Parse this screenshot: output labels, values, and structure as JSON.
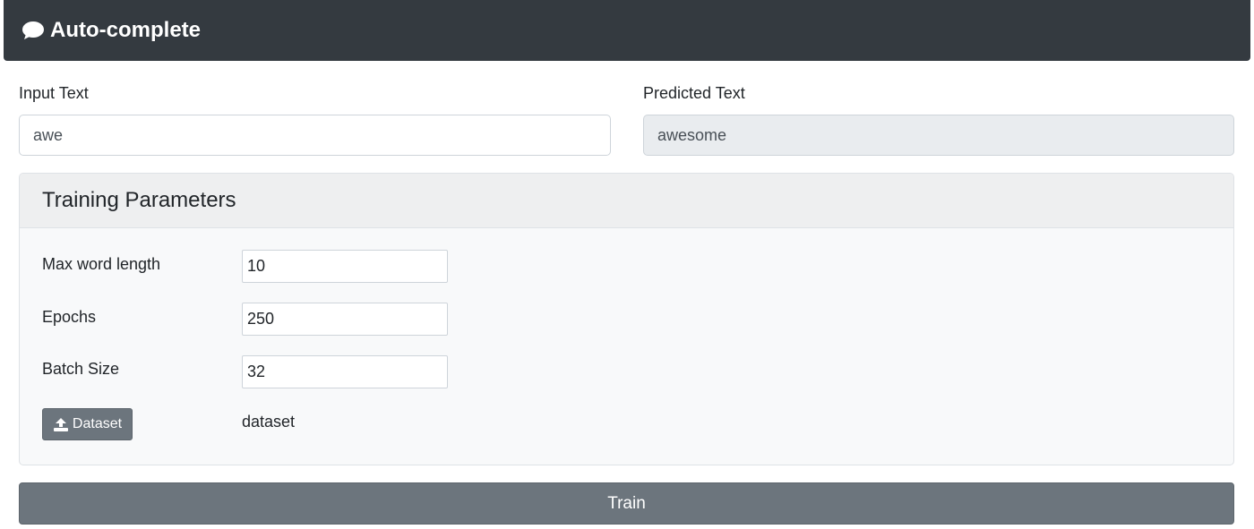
{
  "app": {
    "title": "Auto-complete",
    "icon": "comment-icon"
  },
  "input": {
    "label": "Input Text",
    "value": "awe"
  },
  "prediction": {
    "label": "Predicted Text",
    "value": "awesome"
  },
  "training": {
    "title": "Training Parameters",
    "params": [
      {
        "label": "Max word length",
        "value": "10"
      },
      {
        "label": "Epochs",
        "value": "250"
      },
      {
        "label": "Batch Size",
        "value": "32"
      }
    ],
    "dataset_button": {
      "label": "Dataset",
      "icon": "upload-icon"
    },
    "dataset_name": "dataset"
  },
  "train_button": {
    "label": "Train"
  },
  "colors": {
    "navbar": "#343a40",
    "secondary": "#6c757d",
    "readonly_bg": "#e9ecef",
    "card_bg": "#f8f9fa"
  }
}
